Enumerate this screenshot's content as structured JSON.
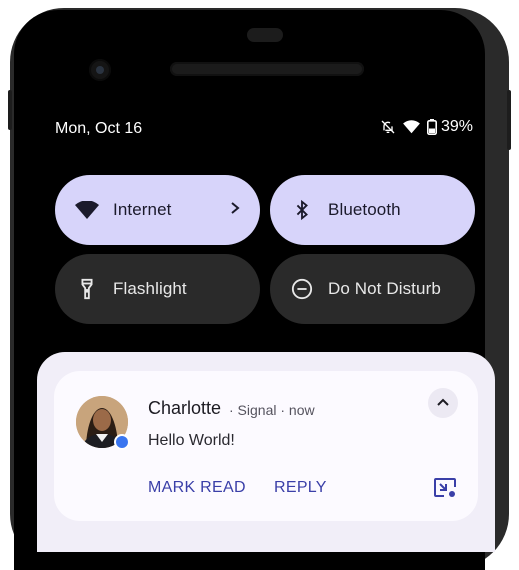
{
  "status_bar": {
    "date": "Mon, Oct 16",
    "battery": "39%"
  },
  "quick_settings": [
    {
      "label": "Internet",
      "state": "on",
      "icon": "wifi-icon",
      "has_chevron": true
    },
    {
      "label": "Bluetooth",
      "state": "on",
      "icon": "bluetooth-icon"
    },
    {
      "label": "Flashlight",
      "state": "off",
      "icon": "flashlight-icon"
    },
    {
      "label": "Do Not Disturb",
      "state": "off",
      "icon": "do-not-disturb-icon"
    }
  ],
  "notification": {
    "sender": "Charlotte",
    "meta": "· Signal · now",
    "message": "Hello World!",
    "actions": [
      "MARK READ",
      "REPLY"
    ]
  },
  "colors": {
    "tile_on": "#d7d4fa",
    "tile_off": "#2a2a2a",
    "action_text": "#3a3fa8",
    "signal_badge": "#3a76f0"
  }
}
